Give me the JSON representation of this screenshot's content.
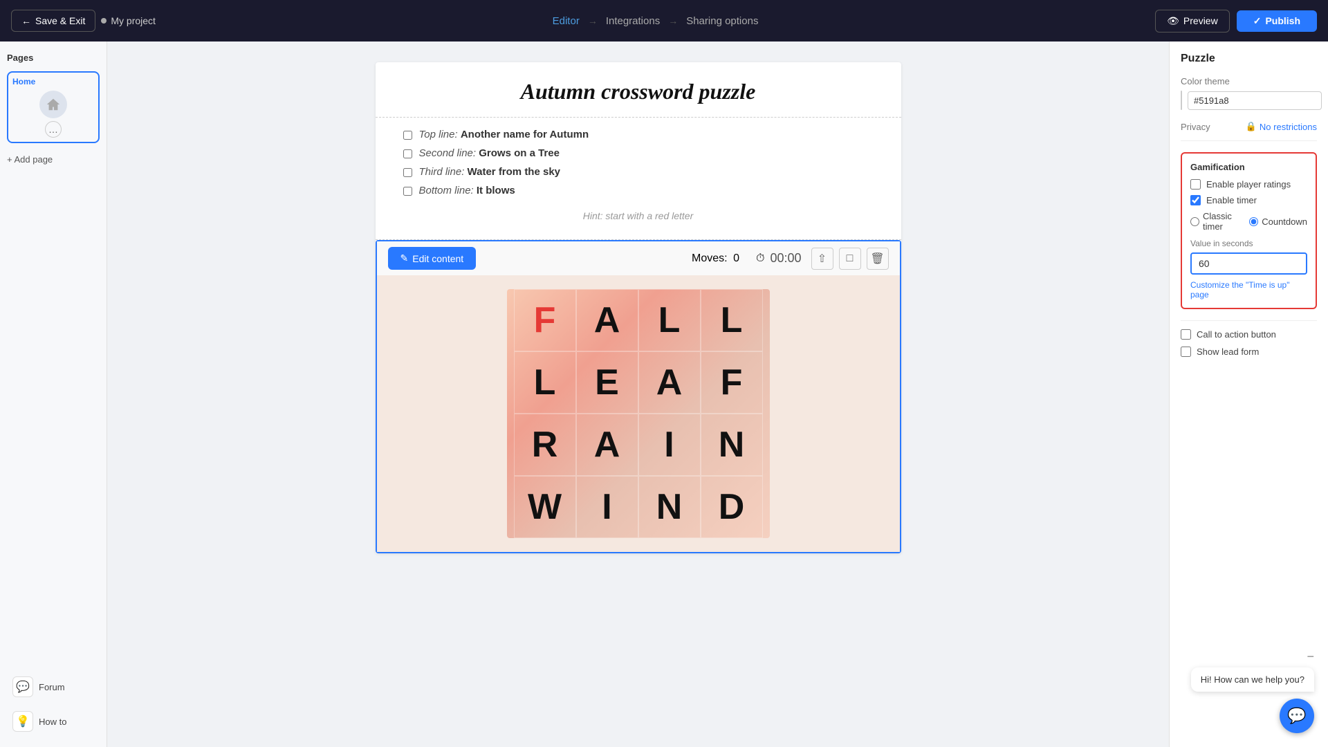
{
  "topnav": {
    "save_exit_label": "Save & Exit",
    "project_name": "My project",
    "step_editor": "Editor",
    "step_integrations": "Integrations",
    "step_sharing": "Sharing options",
    "preview_label": "Preview",
    "publish_label": "Publish"
  },
  "sidebar": {
    "pages_title": "Pages",
    "page_label": "Home",
    "add_page_label": "+ Add page",
    "forum_label": "Forum",
    "how_to_label": "How to"
  },
  "puzzle": {
    "title": "Autumn crossword puzzle",
    "clues": [
      {
        "label": "Top line:",
        "answer": "Another name for Autumn"
      },
      {
        "label": "Second line:",
        "answer": "Grows on a Tree"
      },
      {
        "label": "Third line:",
        "answer": "Water from the sky"
      },
      {
        "label": "Bottom line:",
        "answer": "It blows"
      }
    ],
    "hint": "Hint: start with a red letter",
    "edit_content_label": "Edit content",
    "moves_label": "Moves:",
    "moves_value": "0",
    "timer_display": "00:00",
    "letters": [
      {
        "char": "F",
        "red": true
      },
      {
        "char": "A",
        "red": false
      },
      {
        "char": "L",
        "red": false
      },
      {
        "char": "L",
        "red": false
      },
      {
        "char": "L",
        "red": false
      },
      {
        "char": "E",
        "red": false
      },
      {
        "char": "A",
        "red": false
      },
      {
        "char": "F",
        "red": false
      },
      {
        "char": "R",
        "red": false
      },
      {
        "char": "A",
        "red": false
      },
      {
        "char": "I",
        "red": false
      },
      {
        "char": "N",
        "red": false
      },
      {
        "char": "W",
        "red": false
      },
      {
        "char": "I",
        "red": false
      },
      {
        "char": "N",
        "red": false
      },
      {
        "char": "D",
        "red": false
      }
    ]
  },
  "right_panel": {
    "title": "Puzzle",
    "color_theme_label": "Color theme",
    "color_hex": "#5191a8",
    "privacy_label": "Privacy",
    "privacy_value": "No restrictions",
    "gamification_title": "Gamification",
    "enable_ratings_label": "Enable player ratings",
    "enable_timer_label": "Enable timer",
    "timer_classic_label": "Classic timer",
    "timer_countdown_label": "Countdown",
    "value_seconds_label": "Value in seconds",
    "seconds_value": "60",
    "customize_link_label": "Customize the \"Time is up\" page",
    "call_to_action_label": "Call to action button",
    "show_lead_form_label": "Show lead form"
  },
  "chat": {
    "bubble_text": "Hi! How can we help you?"
  }
}
